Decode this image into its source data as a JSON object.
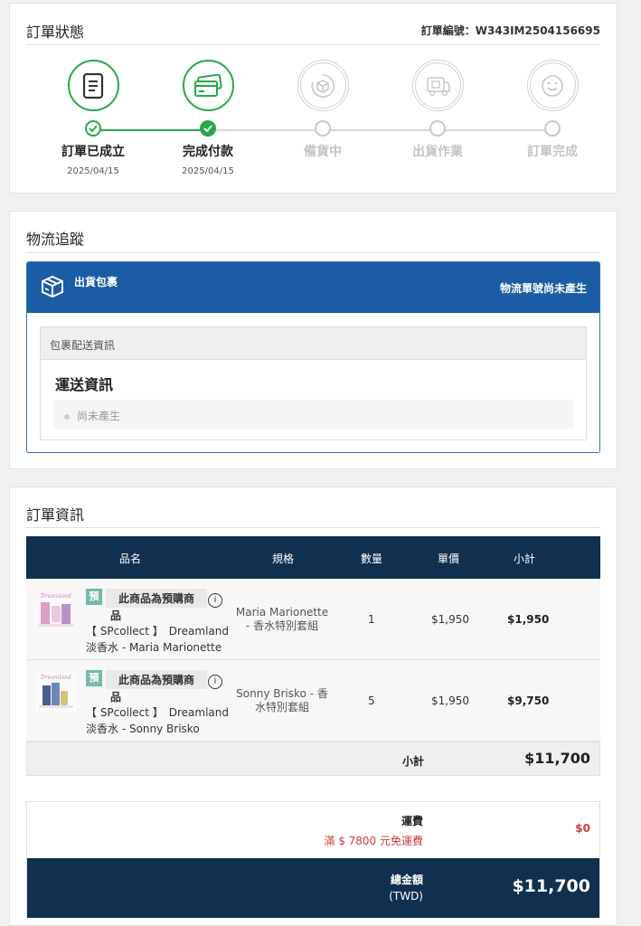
{
  "status": {
    "title": "訂單狀態",
    "order_no": "訂單編號：W343IM2504156695",
    "steps": [
      {
        "label": "訂單已成立",
        "date": "2025/04/15",
        "icon": "document-icon",
        "state": "done"
      },
      {
        "label": "完成付款",
        "date": "2025/04/15",
        "icon": "credit-card-icon",
        "state": "done"
      },
      {
        "label": "備貨中",
        "date": "",
        "icon": "box-refresh-icon",
        "state": "pending"
      },
      {
        "label": "出貨作業",
        "date": "",
        "icon": "delivery-truck-icon",
        "state": "pending"
      },
      {
        "label": "訂單完成",
        "date": "",
        "icon": "smile-icon",
        "state": "pending"
      }
    ]
  },
  "logistics": {
    "title": "物流追蹤",
    "shipment_label": "出貨包裹",
    "tracking_status": "物流單號尚未產生",
    "package_info_header": "包裹配送資訊",
    "shipping_info_title": "運送資訊",
    "shipping_status": "尚未產生"
  },
  "order_info": {
    "title": "訂單資訊",
    "columns": [
      "品名",
      "規格",
      "數量",
      "單價",
      "小計"
    ],
    "items": [
      {
        "badge": "預",
        "preorder_note_1": "此商品為預購商",
        "preorder_note_2": "品",
        "name_1a": "【 SPcollect 】",
        "name_1b": "Dreamland",
        "name_2": "淡香水 - Maria Marionette",
        "spec": "Maria Marionette - 香水特別套組",
        "qty": "1",
        "price": "$1,950",
        "subtotal": "$1,950"
      },
      {
        "badge": "預",
        "preorder_note_1": "此商品為預購商",
        "preorder_note_2": "品",
        "name_1a": "【 SPcollect 】",
        "name_1b": "Dreamland",
        "name_2": "淡香水 - Sonny Brisko",
        "spec": "Sonny Brisko - 香水特別套組",
        "qty": "5",
        "price": "$1,950",
        "subtotal": "$9,750"
      }
    ],
    "subtotal_label": "小計",
    "subtotal_value": "$11,700",
    "shipping_label": "運費",
    "shipping_note": "滿 $ 7800 元免運費",
    "shipping_value": "$0",
    "total_label": "總金額",
    "total_currency": "(TWD)",
    "total_value": "$11,700"
  },
  "colors": {
    "success": "#27a84a",
    "brand_blue": "#1b5ca5",
    "navy": "#112f4f",
    "alert_red": "#d23a3a"
  }
}
